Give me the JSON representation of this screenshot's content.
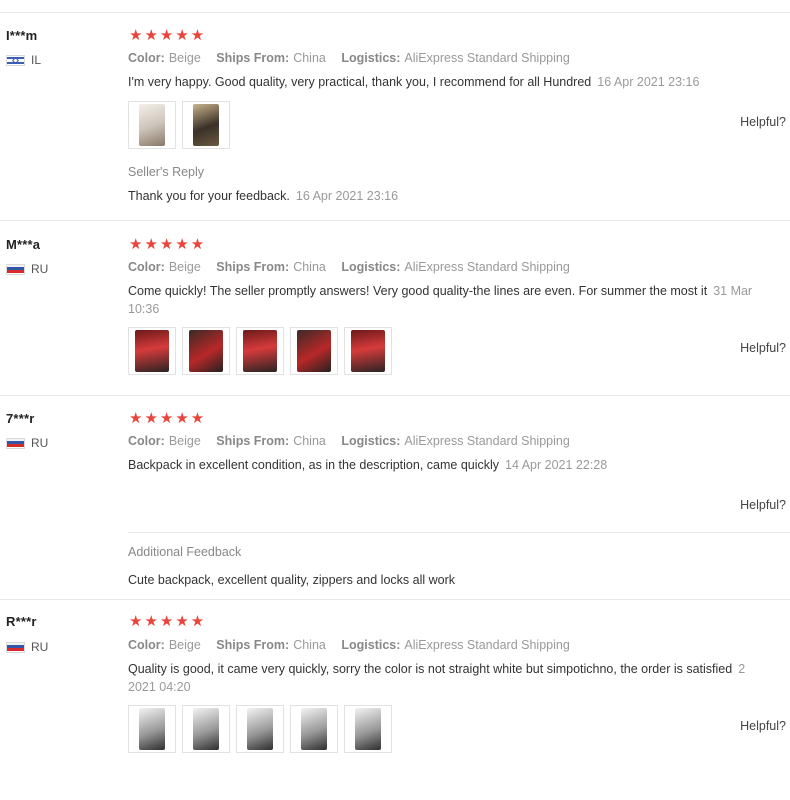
{
  "labels": {
    "color": "Color:",
    "ships_from": "Ships From:",
    "logistics": "Logistics:",
    "helpful": "Helpful?",
    "stars": "★★★★★"
  },
  "colors": {
    "star": "#e8453c",
    "divider": "#e8e8e8"
  },
  "reviews": [
    {
      "user": "I***m",
      "country": "IL",
      "rating": 5,
      "color": "Beige",
      "ships_from": "China",
      "logistics": "AliExpress Standard Shipping",
      "text": "I'm very happy. Good quality, very practical, thank you, I recommend for all Hundred",
      "date": "16 Apr 2021 23:16",
      "photo_count": 2,
      "reply_label": "Seller's Reply",
      "reply_text": "Thank you for your feedback.",
      "reply_date": "16 Apr 2021 23:16"
    },
    {
      "user": "M***a",
      "country": "RU",
      "rating": 5,
      "color": "Beige",
      "ships_from": "China",
      "logistics": "AliExpress Standard Shipping",
      "text": "Come quickly! The seller promptly answers! Very good quality-the lines are even. For summer the most it",
      "date": "31 Mar",
      "date_line2": "10:36",
      "photo_count": 5
    },
    {
      "user": "7***r",
      "country": "RU",
      "rating": 5,
      "color": "Beige",
      "ships_from": "China",
      "logistics": "AliExpress Standard Shipping",
      "text": "Backpack in excellent condition, as in the description, came quickly",
      "date": "14 Apr 2021 22:28",
      "additional_label": "Additional Feedback",
      "additional_text": "Cute backpack, excellent quality, zippers and locks all work"
    },
    {
      "user": "R***r",
      "country": "RU",
      "rating": 5,
      "color": "Beige",
      "ships_from": "China",
      "logistics": "AliExpress Standard Shipping",
      "text": "Quality is good, it came very quickly, sorry the color is not straight white but simpotichno, the order is satisfied",
      "date": "2",
      "date_line2": "2021 04:20",
      "photo_count": 5
    }
  ]
}
